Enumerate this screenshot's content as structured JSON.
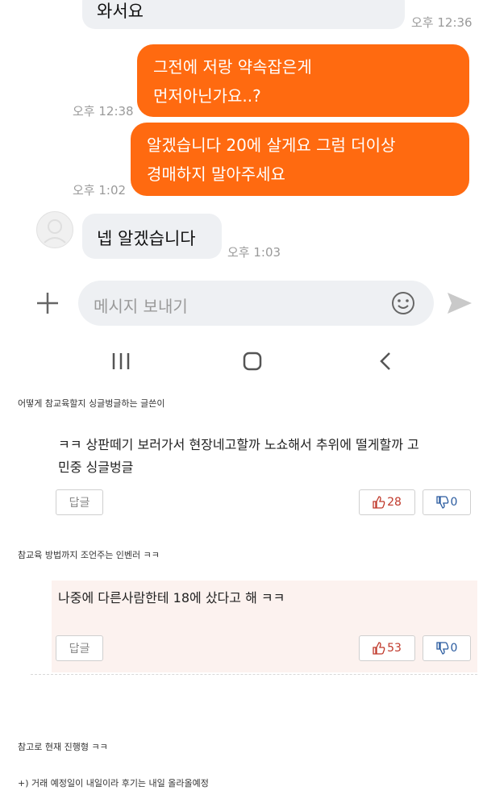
{
  "chat": {
    "msg_in_1": "와서요",
    "msg_in_1_time": "오후 12:36",
    "msg_out_1_line1": "그전에 저랑 약속잡은게",
    "msg_out_1_line2": "먼저아닌가요..?",
    "msg_out_1_time": "오후 12:38",
    "msg_out_2_line1": "알겠습니다 20에 살게요 그럼 더이상",
    "msg_out_2_line2": "경매하지 말아주세요",
    "msg_out_2_time": "오후 1:02",
    "msg_in_2": "넵 알겠습니다",
    "msg_in_2_time": "오후 1:03",
    "input_placeholder": "메시지 보내기"
  },
  "icons": {
    "plus": "plus-icon",
    "emoji": "smiley-icon",
    "send": "send-icon",
    "avatar": "avatar",
    "nav_recent": "recent-apps-icon",
    "nav_home": "home-icon",
    "nav_back": "back-icon",
    "thumb_up": "thumb-up-icon",
    "thumb_down": "thumb-down-icon"
  },
  "colors": {
    "outgoing_bubble": "#ff6a10",
    "incoming_bubble": "#eef0f3",
    "highlight_comment_bg": "#fcf2ef",
    "like_text": "#c0392b",
    "dislike_text": "#2a5b9f"
  },
  "caption1": "어떻게 참교육할지 싱글벙글하는 글쓴이",
  "comments": [
    {
      "text_line1": "ㅋㅋ 상판떼기 보러가서 현장네고할까 노쇼해서 추위에 떨게할까 고",
      "text_line2": "민중 싱글벙글",
      "reply_label": "답글",
      "likes": "28",
      "dislikes": "0"
    },
    {
      "text_line1": "나중에 다른사람한테 18에 샀다고 해 ㅋㅋ",
      "reply_label": "답글",
      "likes": "53",
      "dislikes": "0"
    }
  ],
  "caption2": "참교육 방법까지 조언주는 인벤러 ㅋㅋ",
  "caption3": "참고로 현재 진행형 ㅋㅋ",
  "caption4": "+) 거래 예정일이 내일이라 후기는 내일 올라올예정"
}
